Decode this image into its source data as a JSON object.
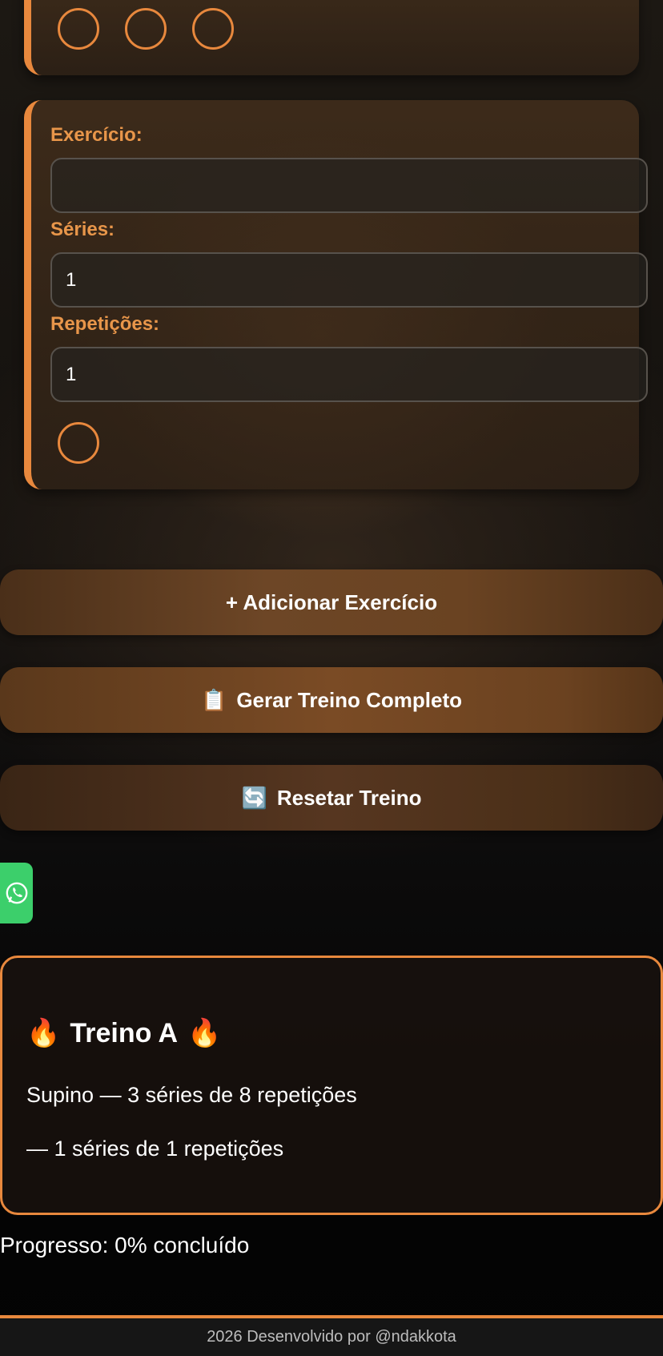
{
  "form": {
    "exercise_label": "Exercício:",
    "exercise_value": "",
    "series_label": "Séries:",
    "series_value": "1",
    "reps_label": "Repetições:",
    "reps_value": "1"
  },
  "buttons": {
    "add_label": "+ Adicionar Exercício",
    "generate_icon": "📋",
    "generate_label": "Gerar Treino Completo",
    "reset_icon": "🔄",
    "reset_label": "Resetar Treino"
  },
  "whatsapp": {
    "icon": "whatsapp-icon"
  },
  "result": {
    "flame": "🔥",
    "title": "Treino A",
    "lines": [
      "Supino — 3 séries de 8 repetições",
      "— 1 séries de 1 repetições"
    ]
  },
  "progress": "Progresso: 0% concluído",
  "footer": "2026 Desenvolvido por @ndakkota",
  "colors": {
    "accent": "#e8883d",
    "label": "#e8964a",
    "whatsapp": "#3ccf6b"
  }
}
